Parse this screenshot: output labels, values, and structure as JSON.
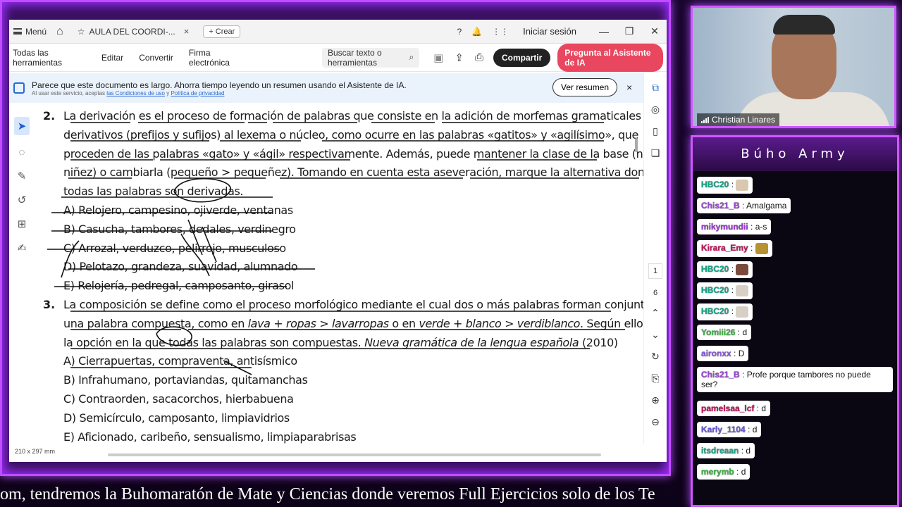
{
  "viewer": {
    "menu_label": "Menú",
    "tab_title": "AULA DEL COORDI-...",
    "tab_close": "×",
    "create_label": "+ Crear",
    "login_label": "Iniciar sesión",
    "tools": [
      "Todas las herramientas",
      "Editar",
      "Convertir",
      "Firma electrónica"
    ],
    "search_placeholder": "Buscar texto o herramientas",
    "share_label": "Compartir",
    "ai_label": "Pregunta al Asistente de IA",
    "banner_text": "Parece que este documento es largo. Ahorra tiempo leyendo un resumen usando el Asistente de IA.",
    "banner_small_pre": "Al usar este servicio, aceptas ",
    "banner_small_link1": "las Condiciones de uso",
    "banner_small_mid": " y ",
    "banner_small_link2": "Política de privacidad",
    "ver_resumen": "Ver resumen",
    "banner_close": "×",
    "page_current": "1",
    "page_total": "6",
    "page_size": "210 x 297 mm"
  },
  "document": {
    "q2_num": "2.",
    "q2_lines": [
      "La derivación es el proceso de formación de palabras que consiste en la adición de morfemas gramaticales",
      "derivativos (prefijos y sufijos) al lexema o núcleo, como ocurre en las palabras «gatitos» y «agilísimo», que",
      "proceden de las palabras «gato» y «ágil» respectivamente. Además, puede mantener la clase de la base (niño >",
      "niñez) o cambiarla (pequeño > pequeñez). Tomando en cuenta esta aseveración, marque la alternativa donde",
      "todas las palabras son derivadas."
    ],
    "q2_options": [
      "A) Relojero, campesino, ojiverde, ventanas",
      "B) Casucha, tambores, dedales, verdinegro",
      "C) Arrozal, verduzco, pelirrojo, musculoso",
      "D) Pelotazo, grandeza, suavidad, alumnado",
      "E) Relojería, pedregal, camposanto, girasol"
    ],
    "q3_num": "3.",
    "q3_line1": "La composición se define como el proceso morfológico mediante el cual dos o más palabras forman conjuntamente",
    "q3_line2_a": "una palabra compuesta, como en ",
    "q3_line2_b": "lava + ropas > lavarropas",
    "q3_line2_c": " o en ",
    "q3_line2_d": "verde + blanco > verdiblanco",
    "q3_line2_e": ". Según ello, ubique",
    "q3_line3_a": "la opción en la que todas las palabras son compuestas. ",
    "q3_line3_b": "Nueva gramática de la lengua española",
    "q3_line3_c": " (2010)",
    "q3_options": [
      "A) Cierrapuertas, compraventa, antisísmico",
      "B) Infrahumano, portaviandas, quitamanchas",
      "C) Contraorden, sacacorchos, hierbabuena",
      "D) Semicírculo, camposanto, limpiavidrios",
      "E) Aficionado, caribeño, sensualismo, limpiaparabrisas"
    ]
  },
  "ticker": {
    "text": "om, tendremos la Buhomaratón de Mate y Ciencias donde veremos Full Ejercicios solo de los Te"
  },
  "cam": {
    "name": "Christian Linares"
  },
  "chat": {
    "title": "Búho Army",
    "messages": [
      {
        "user": "HBC20",
        "color": "#18a88a",
        "text": "",
        "emote": "#d9c7b0"
      },
      {
        "user": "Chis21_B",
        "color": "#9a49d6",
        "text": "Amalgama"
      },
      {
        "user": "mikymundii",
        "color": "#a03ad8",
        "text": "a-s"
      },
      {
        "user": "Kirara_Emy",
        "color": "#c2165a",
        "text": "",
        "emote": "#b69233"
      },
      {
        "user": "HBC20",
        "color": "#18a88a",
        "text": "",
        "emote": "#7a4a3a"
      },
      {
        "user": "HBC20",
        "color": "#18a88a",
        "text": "",
        "emote": "#d8d0c4"
      },
      {
        "user": "HBC20",
        "color": "#18a88a",
        "text": "",
        "emote": "#d8d0c4"
      },
      {
        "user": "Yomiii26",
        "color": "#43b54a",
        "text": "d"
      },
      {
        "user": "aironxx",
        "color": "#8a5be0",
        "text": "D"
      },
      {
        "user": "Chis21_B",
        "color": "#9a49d6",
        "text": "Profe porque tambores no puede ser?"
      },
      {
        "user": "pamelsaa_lcf",
        "color": "#c2165a",
        "text": "d"
      },
      {
        "user": "Karly_1104",
        "color": "#6a5ad8",
        "text": "d"
      },
      {
        "user": "itsdreaan",
        "color": "#18a88a",
        "text": "d"
      },
      {
        "user": "merymb",
        "color": "#43b54a",
        "text": "d"
      }
    ]
  }
}
